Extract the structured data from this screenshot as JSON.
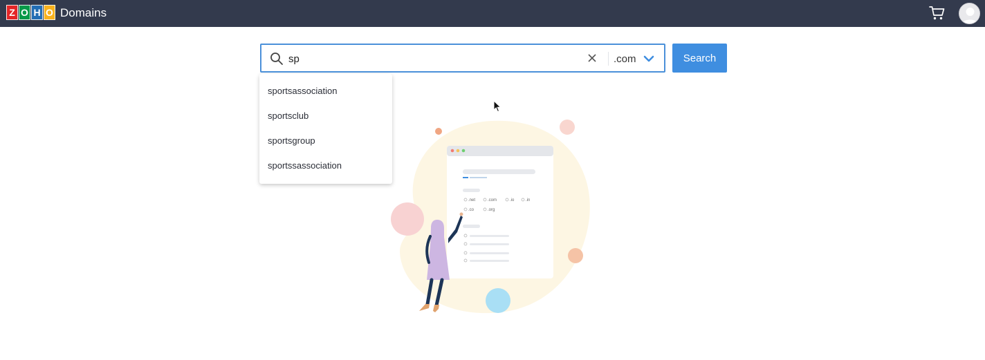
{
  "header": {
    "logo_letters": [
      "Z",
      "O",
      "H",
      "O"
    ],
    "logo_colors": [
      "#e42527",
      "#089949",
      "#226db4",
      "#f9b21d"
    ],
    "app_title": "Domains",
    "cart_icon": "cart-icon",
    "avatar_icon": "user-avatar"
  },
  "search": {
    "value": "sp",
    "placeholder": "",
    "tld": ".com",
    "button_label": "Search",
    "search_icon": "search-icon",
    "clear_icon": "close-icon",
    "tld_chevron": "chevron-down-icon"
  },
  "suggestions": [
    "sportsassociation",
    "sportsclub",
    "sportsgroup",
    "sportssassociation"
  ],
  "illustration": {
    "tlds_row1": [
      ".net",
      ".com",
      ".io",
      ".in"
    ],
    "tlds_row2": [
      ".co",
      ".org"
    ]
  },
  "colors": {
    "header_bg": "#333a4d",
    "accent": "#3f8ee0",
    "input_border": "#4a90d9"
  }
}
